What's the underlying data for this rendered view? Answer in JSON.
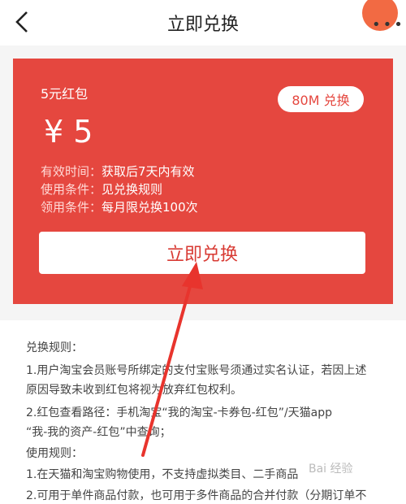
{
  "header": {
    "title": "立即兑换"
  },
  "card": {
    "name": "5元红包",
    "badge": "80M 兑换",
    "price": "¥ 5",
    "validity_label": "有效时间：",
    "validity_value": "获取后7天内有效",
    "condition_label": "使用条件：",
    "condition_value": "见兑换规则",
    "limit_label": "领用条件：",
    "limit_value": "每月限兑换100次",
    "redeem_label": "立即兑换"
  },
  "rules": {
    "lines": [
      "兑换规则：",
      "1.用户淘宝会员账号所绑定的支付宝账号须通过实名认证，若因上述",
      "原因导致未收到红包将视为放弃红包权利。",
      "2.红包查看路径：手机淘宝“我的淘宝-卡券包-红包”/天猫app",
      "“我-我的资产-红包”中查询；",
      "使用规则：",
      "1.在天猫和淘宝购物使用，不支持虚拟类目、二手商品",
      "2.可用于单件商品付款，也可用于多件商品的合并付款（分期订单不"
    ]
  },
  "watermark": "Bai 经验",
  "colors": {
    "accent": "#e5473f",
    "arrow": "#e8342d"
  }
}
